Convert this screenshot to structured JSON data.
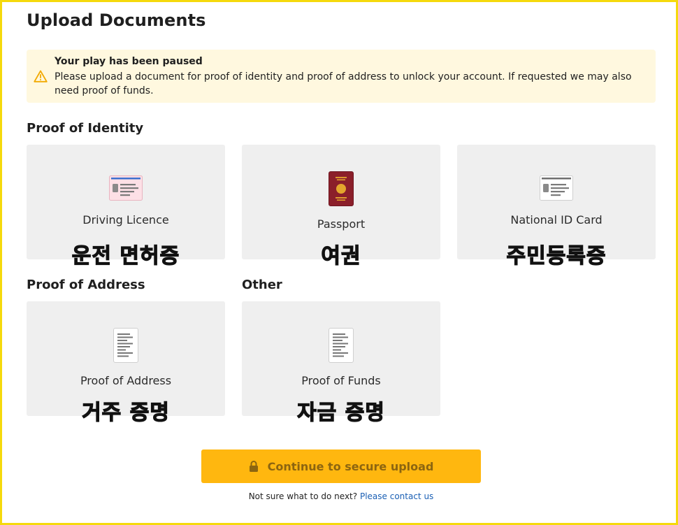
{
  "page": {
    "title": "Upload Documents"
  },
  "alert": {
    "heading": "Your play has been paused",
    "message": "Please upload a document for proof of identity and proof of address to unlock your account. If requested we may also need proof of funds.",
    "icon": "warning-icon",
    "accent": "#f2a900",
    "background": "#fff8df"
  },
  "sections": {
    "identity": "Proof of Identity",
    "address": "Proof of Address",
    "other": "Other"
  },
  "cards": {
    "driving": {
      "label": "Driving Licence",
      "label_ko": "운전 면허증",
      "icon": "driving-licence-icon"
    },
    "passport": {
      "label": "Passport",
      "label_ko": "여권",
      "icon": "passport-icon"
    },
    "national_id": {
      "label": "National ID Card",
      "label_ko": "주민등록증",
      "icon": "national-id-icon"
    },
    "address": {
      "label": "Proof of Address",
      "label_ko": "거주 증명",
      "icon": "document-icon"
    },
    "funds": {
      "label": "Proof of Funds",
      "label_ko": "자금 증명",
      "icon": "document-icon"
    }
  },
  "cta": {
    "label": "Continue to secure upload",
    "icon": "lock-icon",
    "color": "#ffb70f"
  },
  "help": {
    "text": "Not sure what to do next?",
    "link": "Please contact us"
  },
  "colors": {
    "frame": "#f5d90c",
    "card": "#efefef",
    "link": "#1a5fb4"
  }
}
